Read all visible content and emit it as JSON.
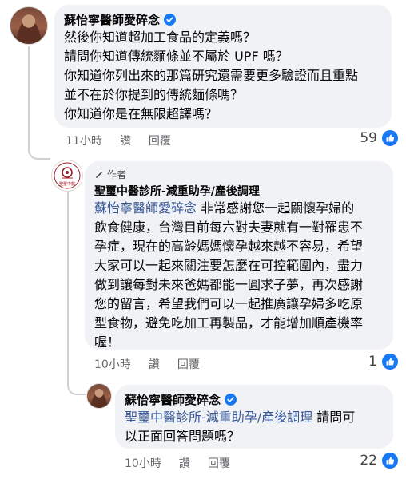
{
  "comment1": {
    "author": "蘇怡寧醫師愛碎念",
    "verified": true,
    "lines": [
      "然後你知道超加工食品的定義嗎？",
      "請問你知道傳統麵條並不屬於 UPF 嗎？",
      "你知道你列出來的那篇研究還需要更多驗證而且重點",
      "並不在於你提到的傳統麵條嗎？",
      "你知道你是在無限超譯嗎？"
    ],
    "time": "11小時",
    "like_label": "讚",
    "reply_label": "回覆",
    "reaction_count": "59"
  },
  "reply1": {
    "author_badge": "作者",
    "author": "聖璽中醫診所-減重助孕/產後調理",
    "tag": "蘇怡寧醫師愛碎念",
    "lines": [
      " 非常感謝您一起關懷孕婦的",
      "飲食健康，台灣目前每六對夫妻就有一對罹患不",
      "孕症，現在的高齡媽媽懷孕越來越不容易，希望",
      "大家可以一起來關注要怎麼在可控範圍內，盡力",
      "做到讓每對未來爸媽都能一圓求子夢，再次感謝",
      "您的留言，希望我們可以一起推廣讓孕婦多吃原",
      "型食物，避免吃加工再製品，才能增加順產機率",
      "喔！"
    ],
    "time": "10小時",
    "like_label": "讚",
    "reply_label": "回覆",
    "reaction_count": "1",
    "logo_text": "聖璽中醫"
  },
  "reply2": {
    "author": "蘇怡寧醫師愛碎念",
    "verified": true,
    "tag": "聖璽中醫診所-減重助孕/產後調理",
    "line1_rest": " 請問可",
    "line2": "以正面回答問題嗎？",
    "time": "10小時",
    "like_label": "讚",
    "reply_label": "回覆",
    "reaction_count": "22"
  },
  "colors": {
    "bubble": "#f0f2f5",
    "link": "#385898",
    "like": "#1877f2",
    "meta": "#65676b"
  }
}
